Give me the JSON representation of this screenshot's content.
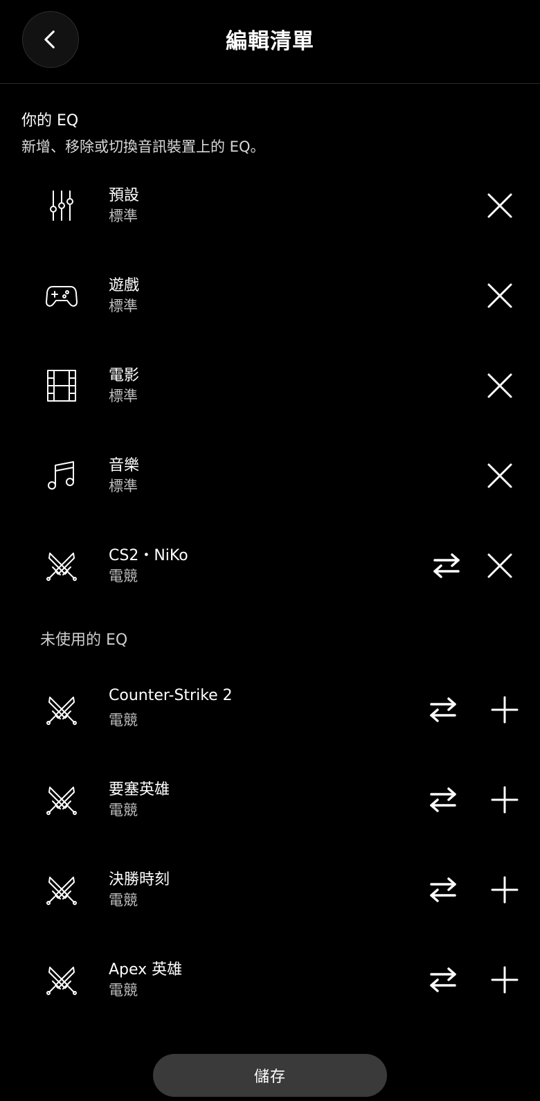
{
  "header": {
    "title": "編輯清單",
    "back_icon": "chevron-left-icon"
  },
  "intro": {
    "title": "你的 EQ",
    "description": "新增、移除或切換音訊裝置上的 EQ。"
  },
  "active_eq": [
    {
      "name": "預設",
      "sub": "標準",
      "icon": "equalizer-icon"
    },
    {
      "name": "遊戲",
      "sub": "標準",
      "icon": "gamepad-icon"
    },
    {
      "name": "電影",
      "sub": "標準",
      "icon": "film-icon"
    },
    {
      "name": "音樂",
      "sub": "標準",
      "icon": "music-note-icon"
    },
    {
      "name": "CS2・NiKo",
      "sub": "電競",
      "icon": "crossed-swords-icon",
      "swap": true
    }
  ],
  "unused": {
    "title": "未使用的 EQ",
    "items": [
      {
        "name": "Counter-Strike 2",
        "sub": "電競",
        "icon": "crossed-swords-icon"
      },
      {
        "name": "要塞英雄",
        "sub": "電競",
        "icon": "crossed-swords-icon"
      },
      {
        "name": "決勝時刻",
        "sub": "電競",
        "icon": "crossed-swords-icon"
      },
      {
        "name": "Apex 英雄",
        "sub": "電競",
        "icon": "crossed-swords-icon"
      }
    ]
  },
  "save_label": "儲存",
  "colors": {
    "background": "#000000",
    "save_button": "#3a3a3a",
    "subtext": "#bdbdbd"
  }
}
